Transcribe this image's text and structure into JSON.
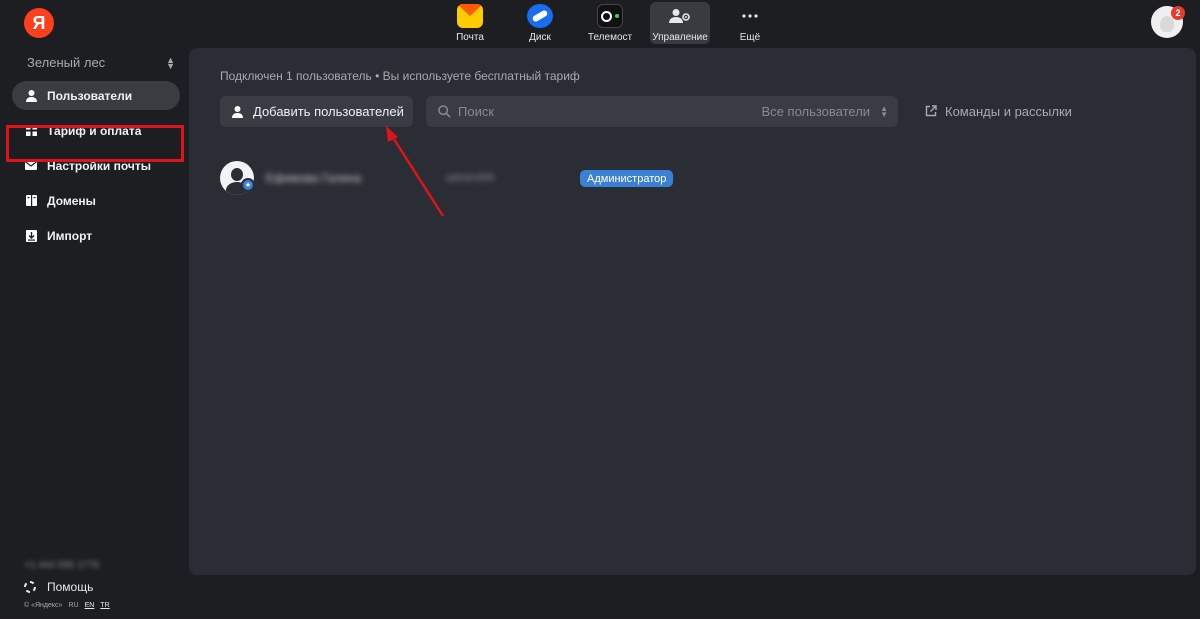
{
  "header": {
    "logo_text": "Я",
    "nav": [
      {
        "label": "Почта",
        "icon": "mail-icon"
      },
      {
        "label": "Диск",
        "icon": "disk-icon"
      },
      {
        "label": "Телемост",
        "icon": "telemost-icon"
      },
      {
        "label": "Управление",
        "icon": "admin-icon",
        "active": true
      },
      {
        "label": "Ещё",
        "icon": "more-icon"
      }
    ],
    "notifications_count": "2"
  },
  "sidebar": {
    "org_name": "Зеленый лес",
    "items": [
      {
        "label": "Пользователи",
        "icon": "user-icon",
        "active": true
      },
      {
        "label": "Тариф и оплата",
        "icon": "grid-icon"
      },
      {
        "label": "Настройки почты",
        "icon": "envelope-icon"
      },
      {
        "label": "Домены",
        "icon": "domain-icon"
      },
      {
        "label": "Импорт",
        "icon": "import-icon"
      }
    ],
    "blurred_info": "+1 444 555 1776",
    "help_label": "Помощь",
    "copyright": "© «Яндекс»",
    "languages": [
      "RU",
      "EN",
      "TR"
    ]
  },
  "main": {
    "subtitle": "Подключен 1 пользователь • Вы используете бесплатный тариф",
    "add_button_label": "Добавить пользователей",
    "search_placeholder": "Поиск",
    "filter_value": "Все пользователи",
    "teams_link": "Команды и рассылки",
    "users": [
      {
        "name": "Ефимова Галина",
        "login": "admin456",
        "role": "Администратор"
      }
    ]
  },
  "colors": {
    "accent_red": "#e0131b",
    "role_badge": "#3c80d6",
    "yandex_logo": "#fc3f1d"
  }
}
